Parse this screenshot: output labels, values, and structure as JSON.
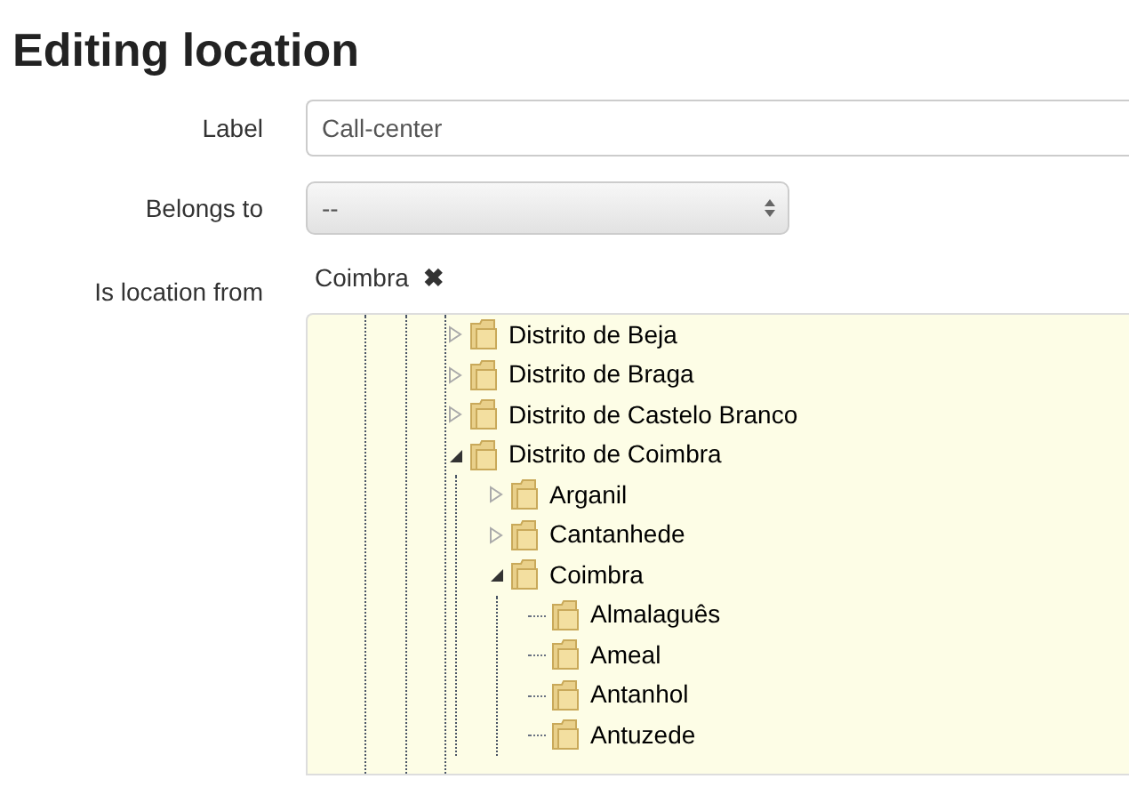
{
  "title": "Editing location",
  "fields": [
    {
      "kind": "text",
      "label": "Label",
      "value": "Call-center"
    },
    {
      "kind": "select",
      "label": "Belongs to",
      "value": "--"
    }
  ],
  "location": {
    "label": "Is location from",
    "chips": [
      "Coimbra"
    ],
    "remove_icon": "✖",
    "tree": [
      {
        "label": "Distrito de Beja",
        "expanded": false
      },
      {
        "label": "Distrito de Braga",
        "expanded": false
      },
      {
        "label": "Distrito de Castelo Branco",
        "expanded": false
      },
      {
        "label": "Distrito de Coimbra",
        "expanded": true,
        "children": [
          {
            "label": "Arganil",
            "expanded": false
          },
          {
            "label": "Cantanhede",
            "expanded": false
          },
          {
            "label": "Coimbra",
            "expanded": true,
            "children": [
              {
                "label": "Almalaguês"
              },
              {
                "label": "Ameal"
              },
              {
                "label": "Antanhol"
              },
              {
                "label": "Antuzede"
              }
            ]
          }
        ]
      }
    ]
  }
}
